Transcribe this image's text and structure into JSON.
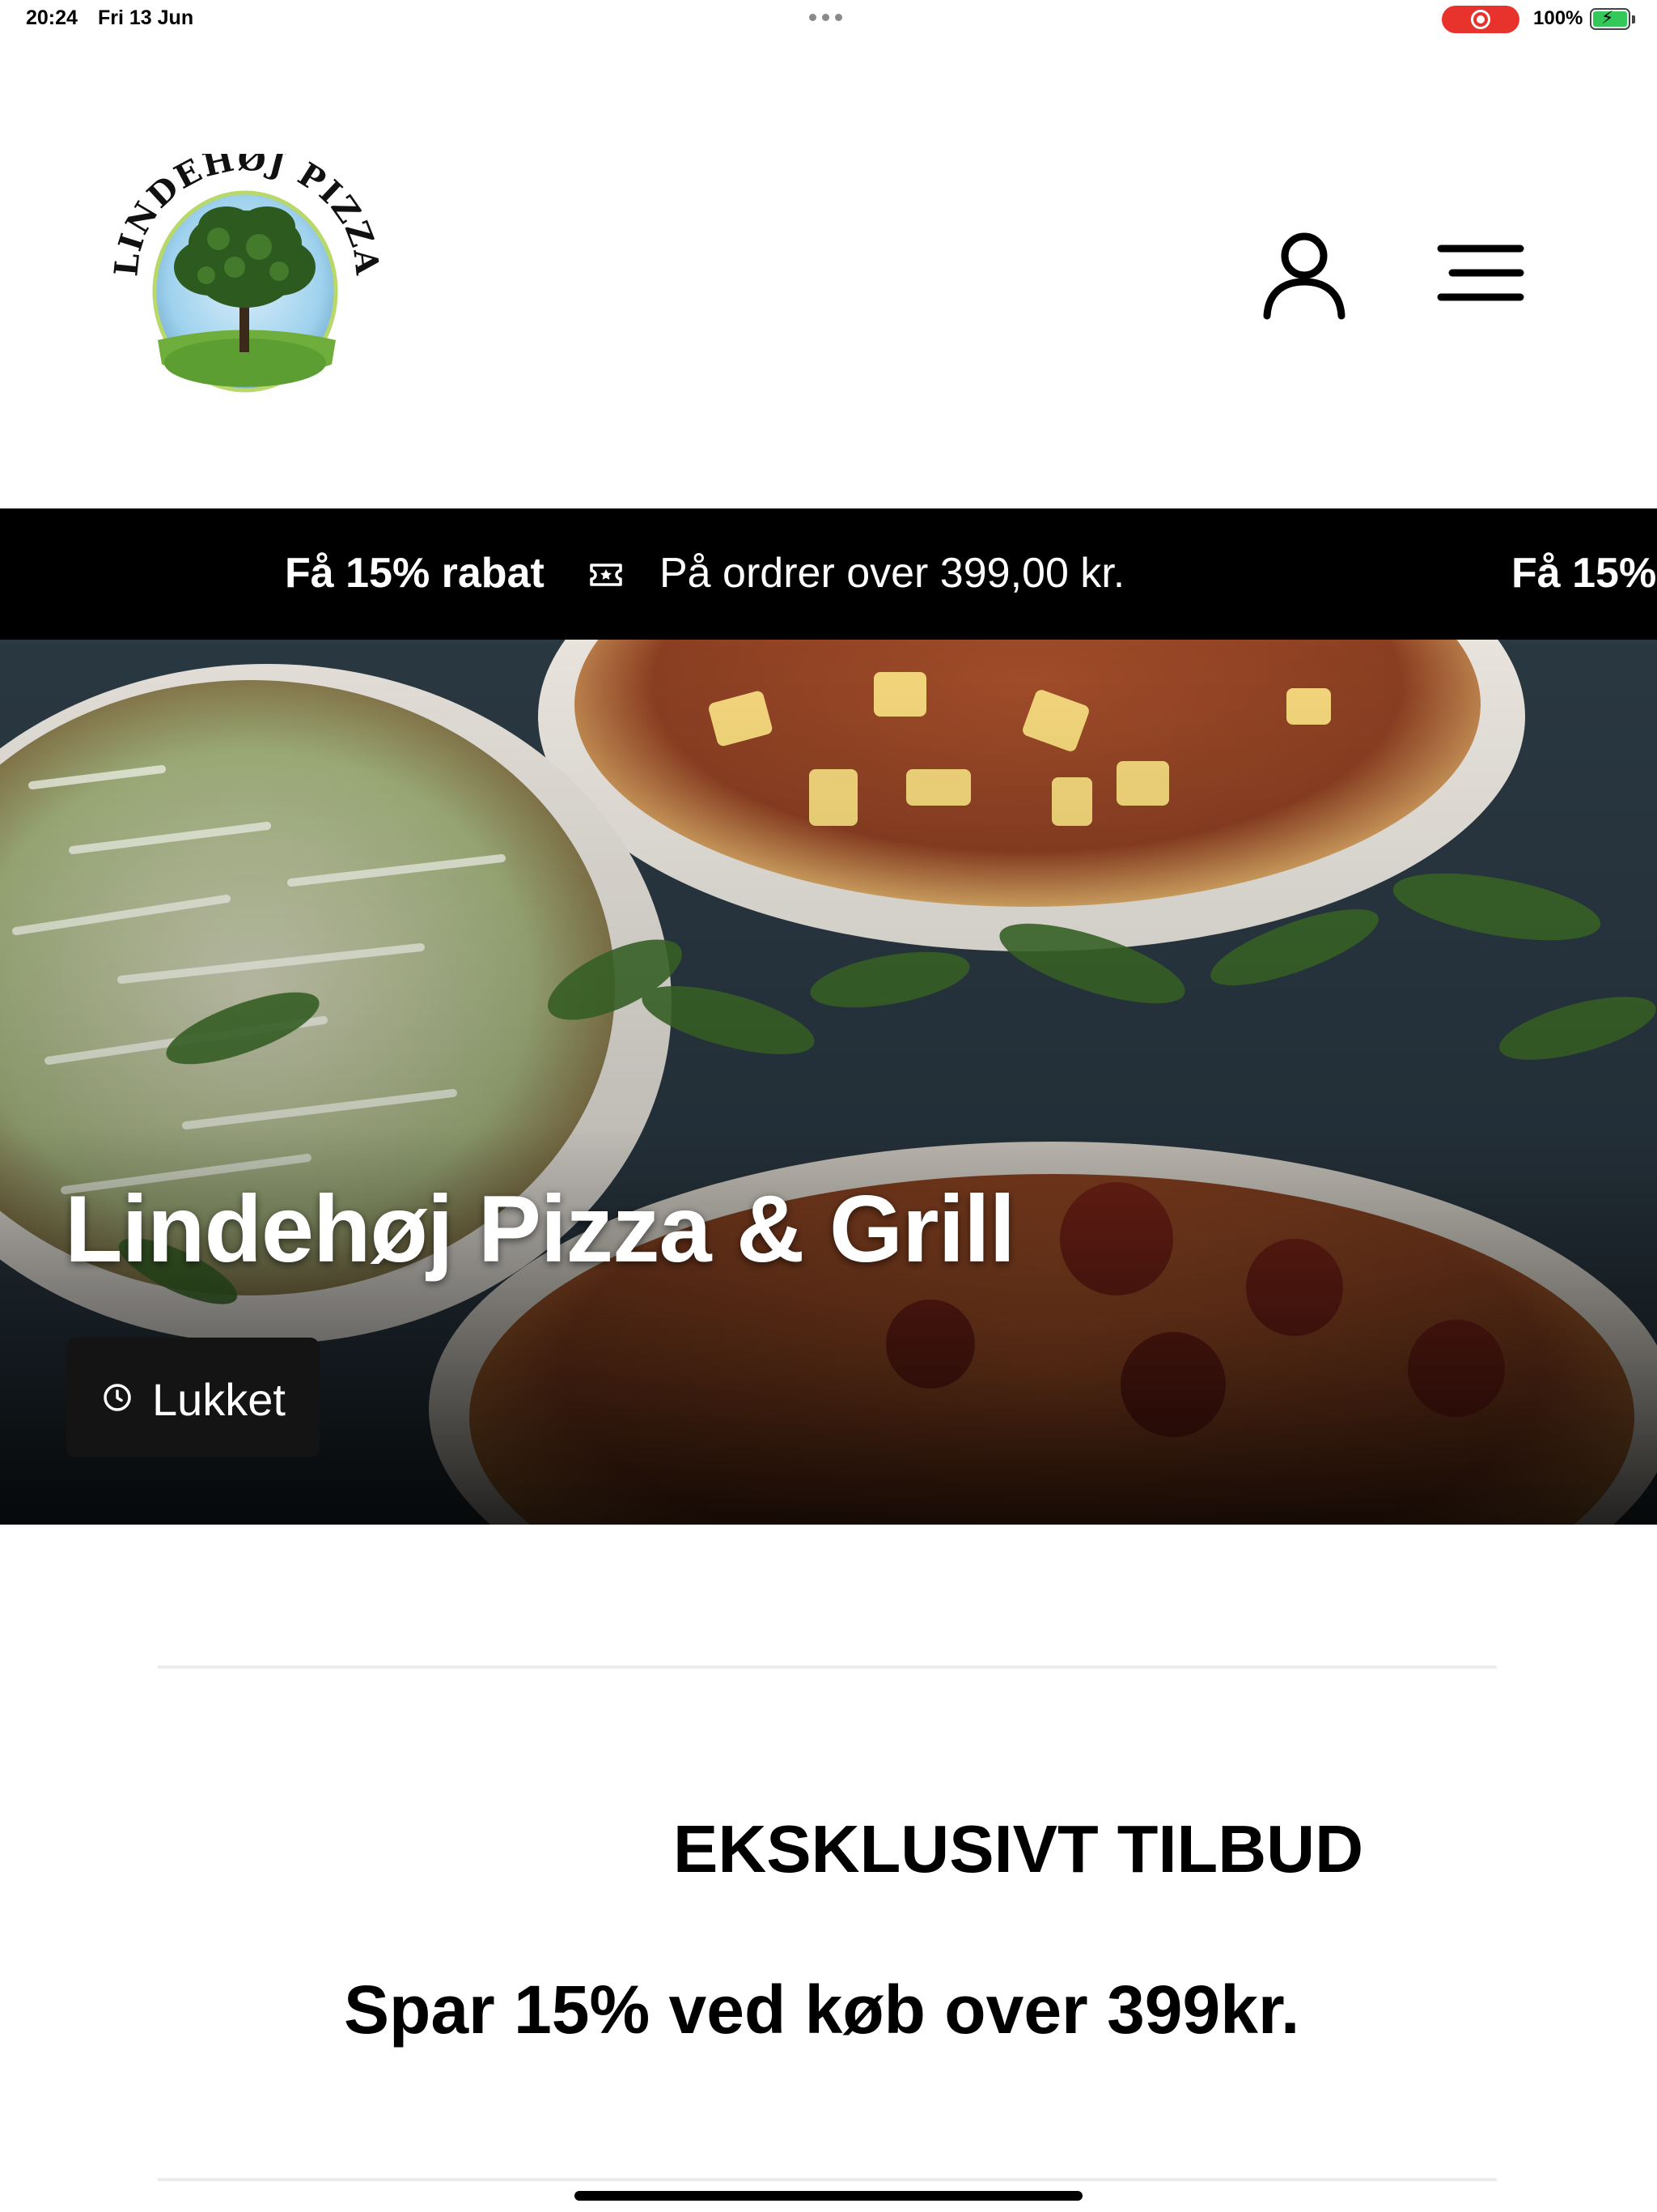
{
  "status_bar": {
    "time": "20:24",
    "date": "Fri 13 Jun",
    "battery": "100%",
    "recording_color": "#e8322c",
    "battery_color": "#34c759"
  },
  "header": {
    "logo_text": "LINDEHØJ PIZZA",
    "user_icon": "user-icon",
    "menu_icon": "hamburger-menu-icon"
  },
  "ribbon": {
    "bold": "Få 15% rabat",
    "icon": "ticket-icon",
    "text": "På ordrer over 399,00 kr.",
    "bold_repeat": "Få 15%",
    "background": "#000000"
  },
  "hero": {
    "title": "Lindehøj Pizza & Grill",
    "status_label": "Lukket",
    "status_icon": "clock-icon"
  },
  "offer": {
    "title": "EKSKLUSIVT TILBUD",
    "subtitle": "Spar 15% ved køb over 399kr."
  }
}
